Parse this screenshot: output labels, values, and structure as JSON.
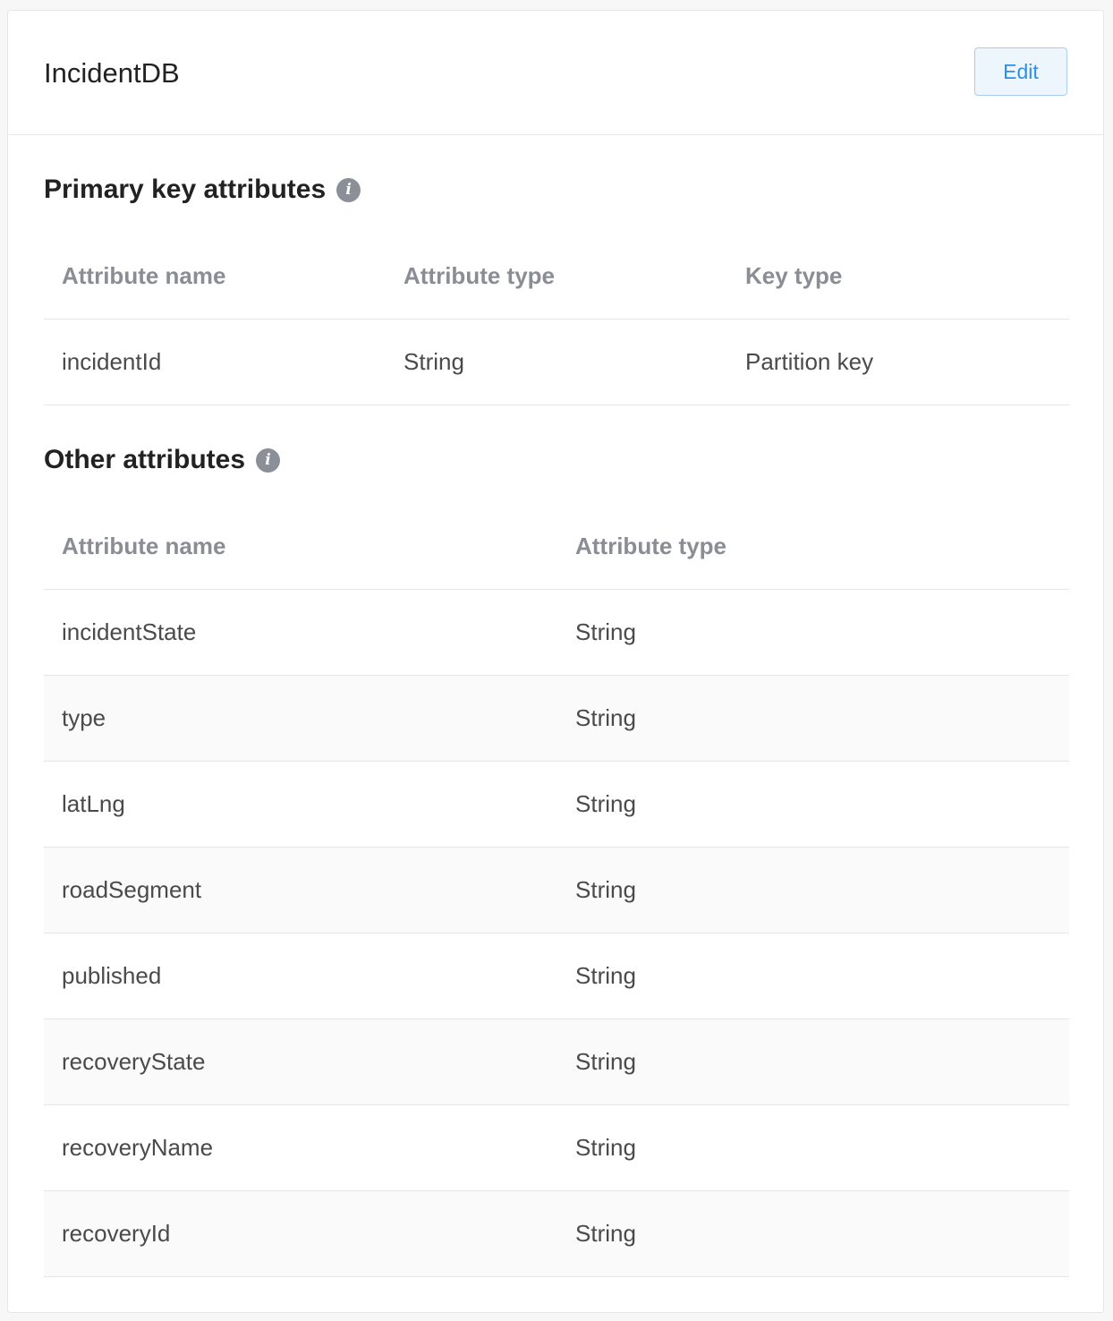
{
  "header": {
    "title": "IncidentDB",
    "edit_label": "Edit"
  },
  "primary": {
    "title": "Primary key attributes",
    "info_glyph": "i",
    "columns": [
      "Attribute name",
      "Attribute type",
      "Key type"
    ],
    "rows": [
      {
        "name": "incidentId",
        "type": "String",
        "key": "Partition key"
      }
    ]
  },
  "other": {
    "title": "Other attributes",
    "info_glyph": "i",
    "columns": [
      "Attribute name",
      "Attribute type"
    ],
    "rows": [
      {
        "name": "incidentState",
        "type": "String"
      },
      {
        "name": "type",
        "type": "String"
      },
      {
        "name": "latLng",
        "type": "String"
      },
      {
        "name": "roadSegment",
        "type": "String"
      },
      {
        "name": "published",
        "type": "String"
      },
      {
        "name": "recoveryState",
        "type": "String"
      },
      {
        "name": "recoveryName",
        "type": "String"
      },
      {
        "name": "recoveryId",
        "type": "String"
      }
    ]
  },
  "icons": {
    "info": "info-icon"
  },
  "colors": {
    "accent": "#2e8fe6",
    "header_text": "#8a8d94",
    "row_alt": "#fafafa"
  }
}
